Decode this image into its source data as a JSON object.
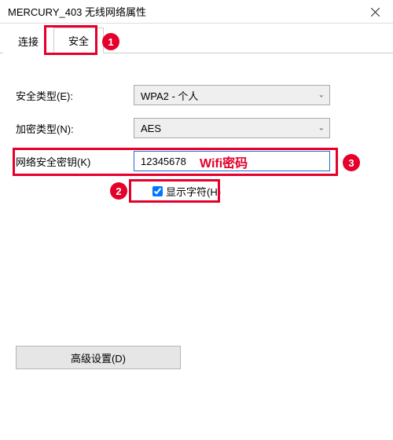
{
  "window": {
    "title": "MERCURY_403 无线网络属性"
  },
  "tabs": {
    "connect": "连接",
    "security": "安全"
  },
  "form": {
    "security_type_label": "安全类型(E):",
    "security_type_value": "WPA2 - 个人",
    "encryption_label": "加密类型(N):",
    "encryption_value": "AES",
    "key_label": "网络安全密钥(K)",
    "key_value": "12345678",
    "show_chars_label": "显示字符(H)",
    "show_chars_checked": true
  },
  "buttons": {
    "advanced": "高级设置(D)"
  },
  "annotations": {
    "b1": "1",
    "b2": "2",
    "b3": "3",
    "wifi_pw": "Wifi密码"
  }
}
